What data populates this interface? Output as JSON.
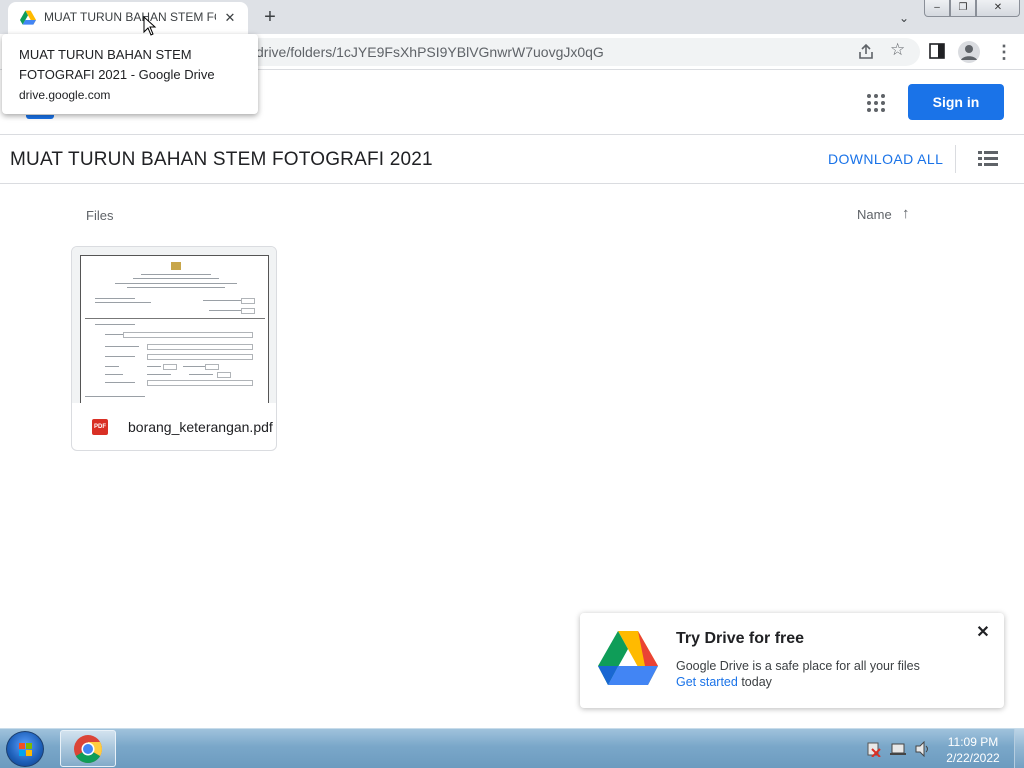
{
  "browser": {
    "tab": {
      "title": "MUAT TURUN BAHAN STEM FOTOGRAFI 2021 - Google Drive",
      "favicon": "google-drive-icon",
      "close_glyph": "✕"
    },
    "new_tab_glyph": "+",
    "tab_search_glyph": "⌄",
    "window_controls": {
      "minimize": "–",
      "maximize": "❐",
      "close": "✕"
    },
    "url_visible": "drive/folders/1cJYE9FsXhPSI9YBlVGnwrW7uovgJx0qG",
    "star_glyph": "☆",
    "menu_glyph": "⋮",
    "hovercard": {
      "title": "MUAT TURUN BAHAN STEM FOTOGRAFI 2021 - Google Drive",
      "domain": "drive.google.com"
    }
  },
  "drive": {
    "sign_in_label": "Sign in",
    "folder_title": "MUAT TURUN BAHAN STEM FOTOGRAFI 2021",
    "download_all_label": "DOWNLOAD ALL",
    "files_label": "Files",
    "sort_label": "Name",
    "sort_arrow": "↑",
    "files": [
      {
        "name": "borang_keterangan.pdf",
        "type_badge": "PDF"
      }
    ],
    "promo": {
      "title": "Try Drive for free",
      "body_prefix": "Google Drive is a safe place for all your files",
      "link_label": "Get started",
      "body_suffix": " today",
      "close_glyph": "✕"
    }
  },
  "taskbar": {
    "time": "11:09 PM",
    "date": "2/22/2022",
    "pinned": [
      "chrome-icon"
    ]
  },
  "colors": {
    "accent": "#1a73e8",
    "pdf_red": "#d93025",
    "tab_bar": "#dee1e6"
  }
}
